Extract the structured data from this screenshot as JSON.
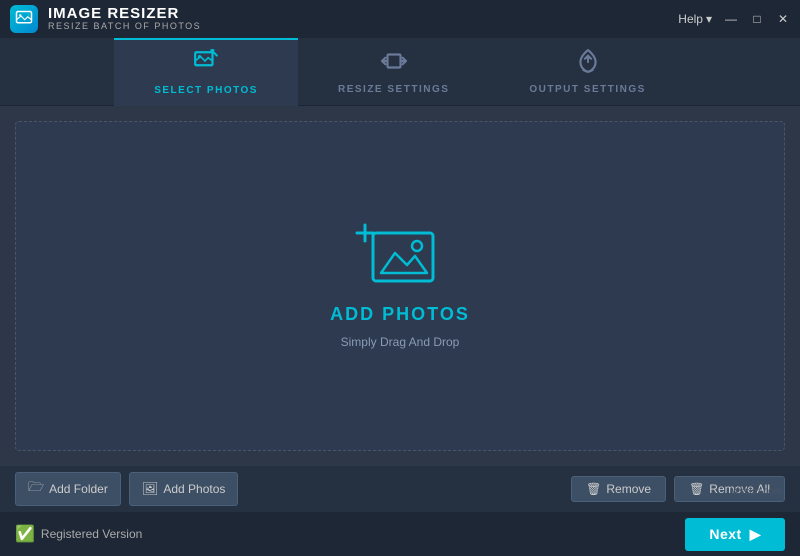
{
  "titleBar": {
    "appName": "IMAGE RESIZER",
    "appSub": "RESIZE BATCH OF PHOTOS",
    "helpLabel": "Help",
    "minBtn": "—",
    "maxBtn": "□",
    "closeBtn": "✕"
  },
  "tabs": [
    {
      "id": "select-photos",
      "label": "SELECT PHOTOS",
      "active": true,
      "iconType": "select"
    },
    {
      "id": "resize-settings",
      "label": "RESIZE SETTINGS",
      "active": false,
      "iconType": "resize"
    },
    {
      "id": "output-settings",
      "label": "OUTPUT SETTINGS",
      "active": false,
      "iconType": "output"
    }
  ],
  "dropZone": {
    "addLabel": "ADD PHOTOS",
    "subLabel": "Simply Drag And Drop"
  },
  "bottomBar": {
    "addFolderBtn": "Add Folder",
    "addPhotosBtn": "Add Photos",
    "removeBtn": "Remove",
    "removeAllBtn": "Remove All"
  },
  "statusBar": {
    "statusText": "Registered Version",
    "nextBtn": "Next"
  },
  "watermark": "wscdn.com"
}
